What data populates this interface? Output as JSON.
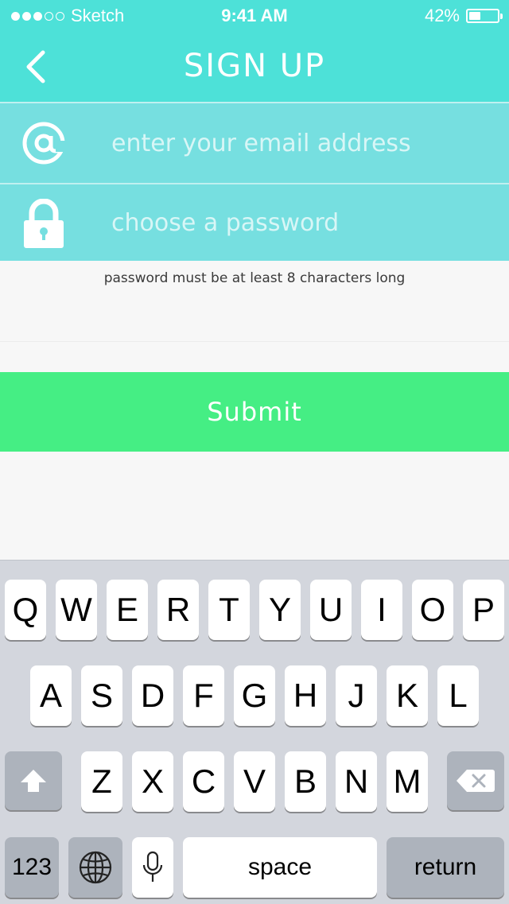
{
  "status_bar": {
    "signal_bars_filled": 3,
    "signal_bars_total": 5,
    "carrier": "Sketch",
    "time": "9:41 AM",
    "battery_percent_label": "42%",
    "battery_level": 0.42
  },
  "nav": {
    "back_icon": "chevron-left-icon",
    "title": "SIGN UP"
  },
  "form": {
    "email": {
      "icon": "at-sign-icon",
      "placeholder": "enter your email address",
      "value": ""
    },
    "password": {
      "icon": "lock-icon",
      "placeholder": "choose a password",
      "value": ""
    },
    "hint": "password must be at least 8 characters long",
    "submit_label": "Submit"
  },
  "keyboard": {
    "row1": [
      "Q",
      "W",
      "E",
      "R",
      "T",
      "Y",
      "U",
      "I",
      "O",
      "P"
    ],
    "row2": [
      "A",
      "S",
      "D",
      "F",
      "G",
      "H",
      "J",
      "K",
      "L"
    ],
    "row3": [
      "Z",
      "X",
      "C",
      "V",
      "B",
      "N",
      "M"
    ],
    "shift_icon": "shift-arrow-icon",
    "delete_icon": "backspace-icon",
    "numbers_label": "123",
    "globe_icon": "globe-icon",
    "mic_icon": "microphone-icon",
    "space_label": "space",
    "return_label": "return"
  },
  "colors": {
    "header": "#4de1d8",
    "field": "#76dfe0",
    "submit": "#45ee84",
    "keyboard_bg": "#d3d6dd"
  }
}
